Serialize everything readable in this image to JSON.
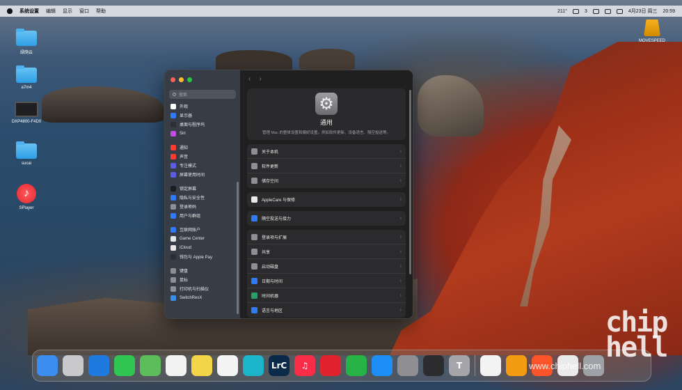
{
  "menubar": {
    "items": [
      "系统设置",
      "编辑",
      "显示",
      "窗口",
      "帮助"
    ],
    "status": [
      "211°",
      "3"
    ],
    "date": "4月23日 周三",
    "time": "20:59"
  },
  "desktop": {
    "icons": [
      "绿荫云",
      "a7m4",
      "DXP4800-F4D0",
      "sucai",
      "SPlayer",
      "MOVESPEED"
    ]
  },
  "window": {
    "search_placeholder": "搜索",
    "sidebar": [
      {
        "label": "外观",
        "color": "#ffffff"
      },
      {
        "label": "显示器",
        "color": "#2f7bf5"
      },
      {
        "label": "桌面与程序坞",
        "color": "#2f2f33"
      },
      {
        "label": "Siri",
        "color": "#c24ee0"
      },
      {
        "label": "通知",
        "color": "#ff3b30"
      },
      {
        "label": "声音",
        "color": "#ff3b30"
      },
      {
        "label": "专注模式",
        "color": "#5e5ce6"
      },
      {
        "label": "屏幕使用时间",
        "color": "#5e5ce6"
      },
      {
        "label": "锁定屏幕",
        "color": "#1c1c1e"
      },
      {
        "label": "隐私与安全性",
        "color": "#2f7bf5"
      },
      {
        "label": "登录密码",
        "color": "#8e8e93"
      },
      {
        "label": "用户与群组",
        "color": "#2f7bf5"
      },
      {
        "label": "互联网账户",
        "color": "#2f7bf5"
      },
      {
        "label": "Game Center",
        "color": "#e8e8e8"
      },
      {
        "label": "iCloud",
        "color": "#e8e8e8"
      },
      {
        "label": "钱包与 Apple Pay",
        "color": "#2f2f33"
      },
      {
        "label": "键盘",
        "color": "#8e8e93"
      },
      {
        "label": "鼠标",
        "color": "#8e8e93"
      },
      {
        "label": "打印机与扫描仪",
        "color": "#8e8e93"
      },
      {
        "label": "SwitchResX",
        "color": "#3a8ee6"
      }
    ],
    "title": "通用",
    "description": "管理 Mac 的整体设置和偏好设置，例如软件更新、设备语言、隔空投送等。",
    "groups": [
      [
        "关于本机",
        "软件更新",
        "储存空间"
      ],
      [
        "AppleCare 与保修"
      ],
      [
        "隔空投送与接力"
      ],
      [
        "登录项与扩展",
        "共享",
        "启动磁盘",
        "日期与时间",
        "时间机器",
        "语言与地区"
      ]
    ]
  },
  "dock": {
    "apps": [
      {
        "name": "finder",
        "color": "#3b8ef0",
        "glyph": ""
      },
      {
        "name": "launchpad",
        "color": "#c9c9cc",
        "glyph": ""
      },
      {
        "name": "safari",
        "color": "#1f7ae0",
        "glyph": ""
      },
      {
        "name": "messages",
        "color": "#31c552",
        "glyph": ""
      },
      {
        "name": "maps",
        "color": "#5cbd5a",
        "glyph": ""
      },
      {
        "name": "photos",
        "color": "#f2f2f2",
        "glyph": ""
      },
      {
        "name": "notes",
        "color": "#f5d548",
        "glyph": ""
      },
      {
        "name": "freeform",
        "color": "#f4f4f4",
        "glyph": ""
      },
      {
        "name": "edge",
        "color": "#1bb4c9",
        "glyph": ""
      },
      {
        "name": "lightroom-classic",
        "color": "#0b2a4a",
        "glyph": "LrC"
      },
      {
        "name": "music",
        "color": "#fa2d48",
        "glyph": "♫"
      },
      {
        "name": "netease-music",
        "color": "#e1232d",
        "glyph": ""
      },
      {
        "name": "numbers",
        "color": "#26b244",
        "glyph": ""
      },
      {
        "name": "app-store",
        "color": "#1d8ef6",
        "glyph": ""
      },
      {
        "name": "system-settings",
        "color": "#8e8e93",
        "glyph": ""
      },
      {
        "name": "iphone-mirroring",
        "color": "#2c2c2e",
        "glyph": ""
      },
      {
        "name": "typora",
        "color": "#a6a6aa",
        "glyph": "T"
      },
      {
        "name": "chrome",
        "color": "#f3f3f3",
        "glyph": ""
      },
      {
        "name": "xiaohongshu",
        "color": "#f39c12",
        "glyph": ""
      },
      {
        "name": "brave",
        "color": "#fb542b",
        "glyph": ""
      },
      {
        "name": "document",
        "color": "#eaeaea",
        "glyph": ""
      },
      {
        "name": "trash",
        "color": "#9ea1a6",
        "glyph": ""
      }
    ]
  },
  "watermark": {
    "logo": "chip hell",
    "url": "www.chiphell.com"
  }
}
